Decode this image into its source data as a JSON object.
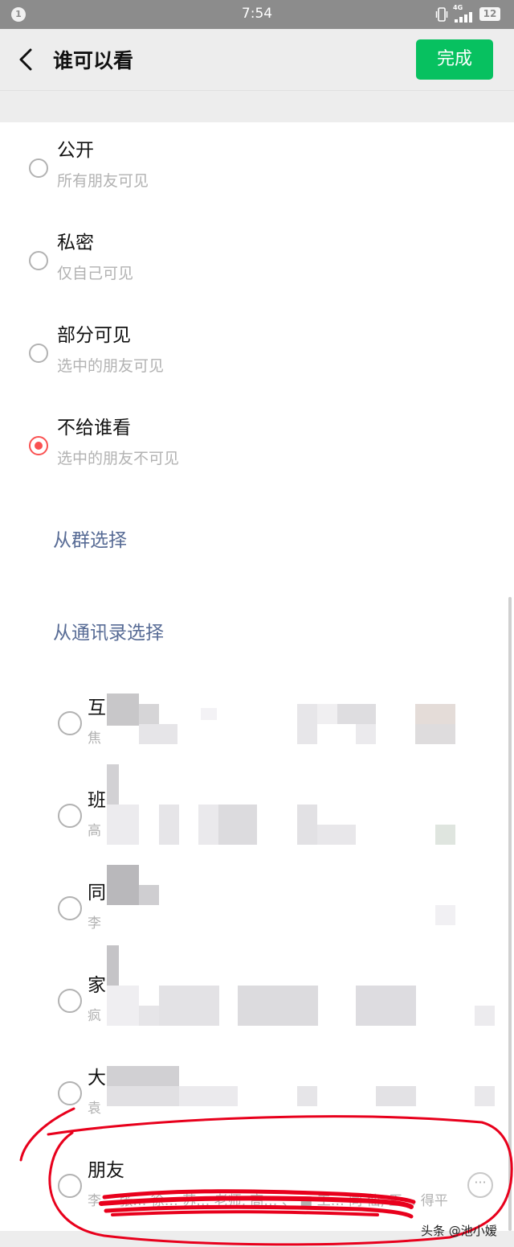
{
  "status_bar": {
    "time": "7:54",
    "notification_count": "1",
    "network": "4G",
    "battery": "12"
  },
  "header": {
    "title": "谁可以看",
    "done_label": "完成",
    "back_icon": "chevron-left-icon"
  },
  "options": [
    {
      "title": "公开",
      "subtitle": "所有朋友可见",
      "selected": false
    },
    {
      "title": "私密",
      "subtitle": "仅自己可见",
      "selected": false
    },
    {
      "title": "部分可见",
      "subtitle": "选中的朋友可见",
      "selected": false
    },
    {
      "title": "不给谁看",
      "subtitle": "选中的朋友不可见",
      "selected": true
    }
  ],
  "select_links": {
    "from_group": "从群选择",
    "from_contacts": "从通讯录选择"
  },
  "tags": [
    {
      "name": "互",
      "members": "焦"
    },
    {
      "name": "班",
      "members": "高"
    },
    {
      "name": "同",
      "members": "李"
    },
    {
      "name": "家",
      "members": "疯"
    },
    {
      "name": "大",
      "members": "袁"
    },
    {
      "name": "朋友",
      "members": "李… 张… 徐… 苏… 老师, 高… 、 ■ 工… 同 仙, 王… 得平, …"
    }
  ],
  "watermark": "头条 @池小嫒",
  "colors": {
    "accent_green": "#07c160",
    "selected_red": "#fa5151",
    "link_blue": "#576b95",
    "annotation_red": "#e8001c"
  }
}
